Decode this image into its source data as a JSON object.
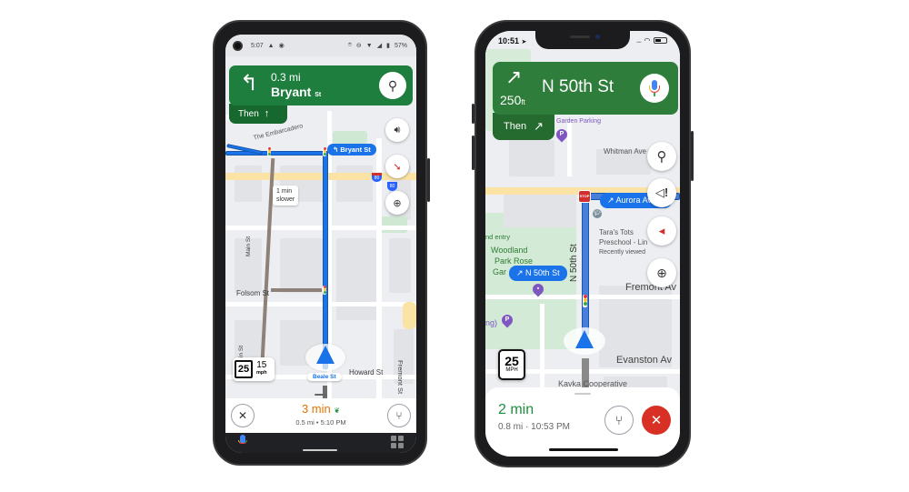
{
  "android": {
    "status_bar": {
      "time": "5:07",
      "battery": "57%"
    },
    "banner": {
      "turn_icon": "turn-left-arrow",
      "distance": "0.3 mi",
      "street_name": "Bryant",
      "street_suffix": "St",
      "then_label": "Then",
      "then_icon": "straight-arrow"
    },
    "map": {
      "turn_pill": "Bryant St",
      "traffic_note_line1": "1 min",
      "traffic_note_line2": "slower",
      "labels": {
        "embarcadero": "The Embarcadero",
        "folsom": "Folsom St",
        "main": "Main St",
        "howard": "Howard St",
        "fremont": "Fremont St",
        "current_street": "Beale St"
      },
      "highway_shields": [
        "80",
        "80"
      ]
    },
    "speed_limit": {
      "limit": "25",
      "current": "15",
      "unit": "mph"
    },
    "bottom": {
      "eta_duration": "3 min",
      "distance": "0.5 mi",
      "arrival_time": "5:10 PM",
      "separator": "•"
    }
  },
  "iphone": {
    "status_bar": {
      "time": "10:51"
    },
    "banner": {
      "turn_icon": "turn-slight-right-arrow",
      "distance": "250",
      "distance_unit": "ft",
      "street_name": "N 50th St",
      "then_label": "Then",
      "then_icon": "slight-right-arrow"
    },
    "map": {
      "turn_pill_main": "N 50th St",
      "turn_pill_secondary": "Aurora Ave N",
      "labels": {
        "garden_parking": "Garden Parking",
        "whitman": "Whitman Ave",
        "entry": "nd entry",
        "woodland": "Woodland",
        "park_rose": "Park Rose",
        "garden": "Gar",
        "parking": "ng)",
        "taras_tots_1": "Tara's Tots",
        "taras_tots_2": "Preschool - Lin",
        "recently_viewed": "Recently viewed",
        "fremont": "Fremont Av",
        "evanston": "Evanston Av",
        "kavka": "Kavka Cooperative",
        "n50th_vertical": "N 50th St",
        "stop": "STOP"
      }
    },
    "speed_limit": {
      "limit": "25",
      "unit": "MPH"
    },
    "bottom": {
      "eta_duration": "2 min",
      "distance": "0.8 mi",
      "arrival_time": "10:53 PM",
      "separator": "·"
    }
  },
  "colors": {
    "android_banner": "#1e7e3e",
    "android_then": "#17682f",
    "iphone_banner": "#2e7d3a",
    "route_blue": "#1a73e8",
    "eta_orange": "#e37400",
    "eta_green": "#1e8e3e",
    "close_red": "#d93025"
  }
}
